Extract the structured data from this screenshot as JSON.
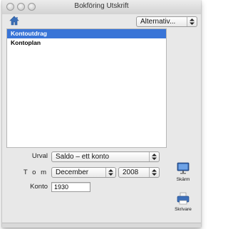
{
  "window": {
    "title": "Bokföring Utskrift"
  },
  "toolbar": {
    "alternatives_label": "Alternativ..."
  },
  "list": {
    "items": [
      {
        "label": "Kontoutdrag",
        "selected": true
      },
      {
        "label": "Kontoplan",
        "selected": false
      }
    ]
  },
  "form": {
    "urval_label": "Urval",
    "urval_value": "Saldo – ett konto",
    "tom_label": "T o m",
    "month_value": "December",
    "year_value": "2008",
    "konto_label": "Konto",
    "konto_value": "1930"
  },
  "side": {
    "screen_label": "Skärm",
    "printer_label": "Skrivare"
  },
  "colors": {
    "selection": "#3874d7",
    "window_bg": "#e8e8e8"
  }
}
